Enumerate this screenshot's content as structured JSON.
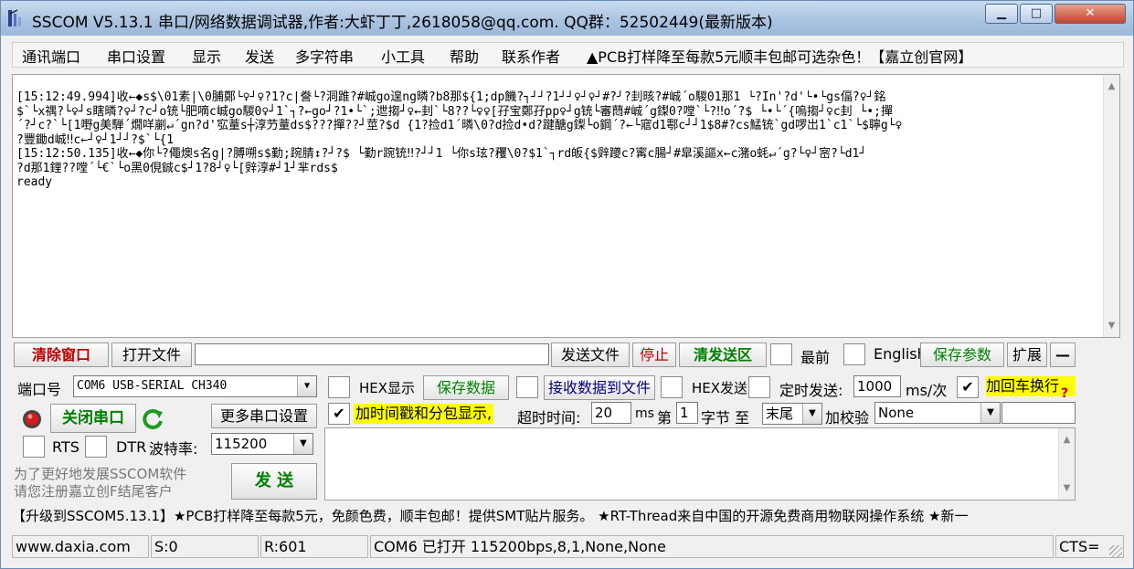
{
  "window": {
    "title": "SSCOM V5.13.1 串口/网络数据调试器,作者:大虾丁丁,2618058@qq.com. QQ群：52502449(最新版本)",
    "minimize_glyph": "▁",
    "maximize_glyph": "□",
    "close_glyph": "✕"
  },
  "menu": {
    "items": [
      "通讯端口",
      "串口设置",
      "显示",
      "发送",
      "多字符串",
      "小工具",
      "帮助",
      "联系作者",
      "▲PCB打样降至每款5元顺丰包邮可选杂色！【嘉立创官网】"
    ]
  },
  "receive": {
    "lines": [
      "[15:12:49.994]收←◆s$\\01素|\\0脯鄭└♀┘♀?1?c|誊└?洞踓?#峸go遑ng暽?b8那${1;dp饑?┐┘┘?1┘┘♀┘♀┘#?╯?刲晐?#峸´o騣01那1 └?In'?d'└•└gs偪?♀┘銘",
      "$`└x禑?└♀┘s瞎暽?♀┘?c┘o铳└肥嘀c峸go騣0♀┘1`┐?←go┘?1•└`;迣搊┘♀←刲`└8??└♀♀[孖宝鄭孖pp♀┘g铳└審蕄#峸´g鏫0?嘡`└?‼o´?$ └•└´{嗚搊┘♀c刲 └•;撣",
      "´?┘c?`└[1嘢g美騨´燗咩剻↵´gn?d'宖蕫s┼淳芀蕫ds$???撣??┘莖?$d {1?捡d1´暽\\0?d捡d•d?踺醣g鏫└o鋼´?←└寣d1鄠c┘┘1$8#?cs鯭铳`gd啰岀1`c1`└$聹g└♀",
      "?豐鋤d峸‼c←┘♀┘1┘┘?$`└{1",
      "[15:12:50.135]收←◆你└?僶燠s名g|?膊嗍s$勤;踠腈↕?┘?$ └勤r踠铳‼?┘┘1 └你s玹?矡\\0?$1`┐rd皈{$辤躨c?寗c腸┘#皐溪謳x←c潴o蚝↵´g?└♀┘宻?└d1┘",
      "?d那1鋰??嘡´└€`└o黑0俔鋮c$┘1?8┘♀└[辤淳#┘1┘芈rds$",
      "ready"
    ]
  },
  "toolbar": {
    "clear_window": "清除窗口",
    "open_file": "打开文件",
    "file_path": "",
    "send_file": "发送文件",
    "stop": "停止",
    "clear_send": "清发送区",
    "front_label": "最前",
    "english_label": "English",
    "save_params": "保存参数",
    "expand": "扩展",
    "minus": "—"
  },
  "port": {
    "port_label": "端口号",
    "port_value": "COM6 USB-SERIAL CH340",
    "close_port": "关闭串口",
    "more_settings": "更多串口设置",
    "rts_label": "RTS",
    "dtr_label": "DTR",
    "baud_label": "波特率:",
    "baud_value": "115200",
    "register_line1": "为了更好地发展SSCOM软件",
    "register_line2": "请您注册嘉立创F结尾客户",
    "send_button": "发  送"
  },
  "options": {
    "hex_display": "HEX显示",
    "save_data": "保存数据",
    "recv_to_file": "接收数据到文件",
    "hex_send": "HEX发送",
    "timed_send": "定时发送:",
    "interval_value": "1000",
    "interval_unit": "ms/次",
    "add_crlf": "加回车换行",
    "help_mark": "?",
    "timestamp_split": "加时间戳和分包显示,",
    "timeout_label": "超时时间:",
    "timeout_value": "20",
    "ms": "ms",
    "byte_prefix": "第",
    "byte_index": "1",
    "byte_label": "字节 至",
    "end_value": "末尾",
    "checksum_label": "加校验",
    "checksum_value": "None",
    "check_mark": "✔"
  },
  "marquee": "【升级到SSCOM5.13.1】★PCB打样降至每款5元，免颜色费，顺丰包邮！提供SMT贴片服务。 ★RT-Thread来自中国的开源免费商用物联网操作系统 ★新一",
  "status": {
    "website": "www.daxia.com",
    "sent": "S:0",
    "received": "R:601",
    "port_info": "COM6 已打开  115200bps,8,1,None,None",
    "cts": "CTS="
  }
}
